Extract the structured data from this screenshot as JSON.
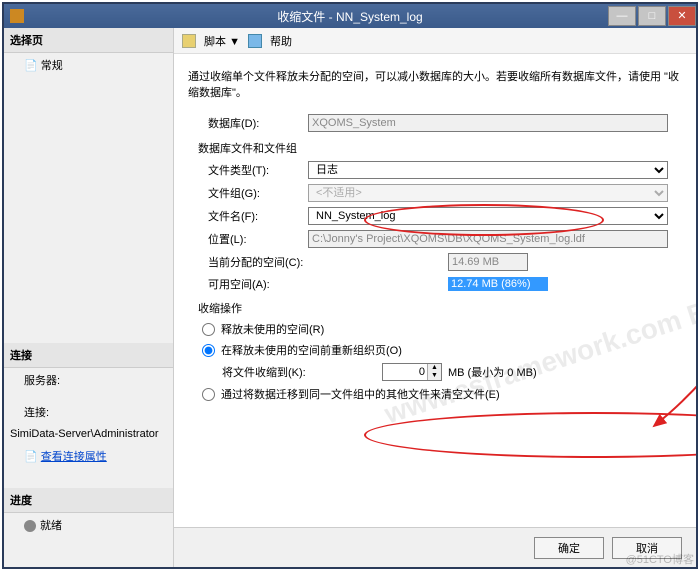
{
  "titlebar": {
    "prefix": "收缩文件 -",
    "name": "NN_System_log"
  },
  "winbtns": {
    "min": "—",
    "max": "□",
    "close": "✕"
  },
  "sidebar": {
    "select_page": "选择页",
    "general": "常规",
    "connection": "连接",
    "server_label": "服务器:",
    "server_value": "",
    "conn_label": "连接:",
    "conn_value": "SimiData-Server\\Administrator",
    "view_conn": "查看连接属性",
    "progress": "进度",
    "ready": "就绪"
  },
  "toolbar": {
    "script": "脚本",
    "help": "帮助",
    "dd": "▼"
  },
  "content": {
    "desc": "通过收缩单个文件释放未分配的空间，可以减小数据库的大小。若要收缩所有数据库文件，请使用 \"收缩数据库\"。",
    "db_label": "数据库(D):",
    "db_value": "XQOMS_System",
    "grp_files": "数据库文件和文件组",
    "file_type_label": "文件类型(T):",
    "file_type_value": "日志",
    "filegroup_label": "文件组(G):",
    "filegroup_value": "<不适用>",
    "filename_label": "文件名(F):",
    "filename_value": "NN_System_log",
    "location_label": "位置(L):",
    "location_value": "C:\\Jonny's Project\\XQOMS\\DB\\XQOMS_System_log.ldf",
    "alloc_label": "当前分配的空间(C):",
    "alloc_value": "14.69 MB",
    "avail_label": "可用空间(A):",
    "avail_value": "12.74 MB (86%)",
    "shrink_grp": "收缩操作",
    "opt_release": "释放未使用的空间(R)",
    "opt_reorg": "在释放未使用的空间前重新组织页(O)",
    "shrink_to_label": "将文件收缩到(K):",
    "shrink_to_value": "0",
    "shrink_to_suffix": "MB (最小为 0 MB)",
    "opt_migrate": "通过将数据迁移到同一文件组中的其他文件来清空文件(E)"
  },
  "footer": {
    "ok": "确定",
    "cancel": "取消"
  },
  "watermark": "www.csframework.com B/S框架网",
  "wm2": "@51CTO博客"
}
